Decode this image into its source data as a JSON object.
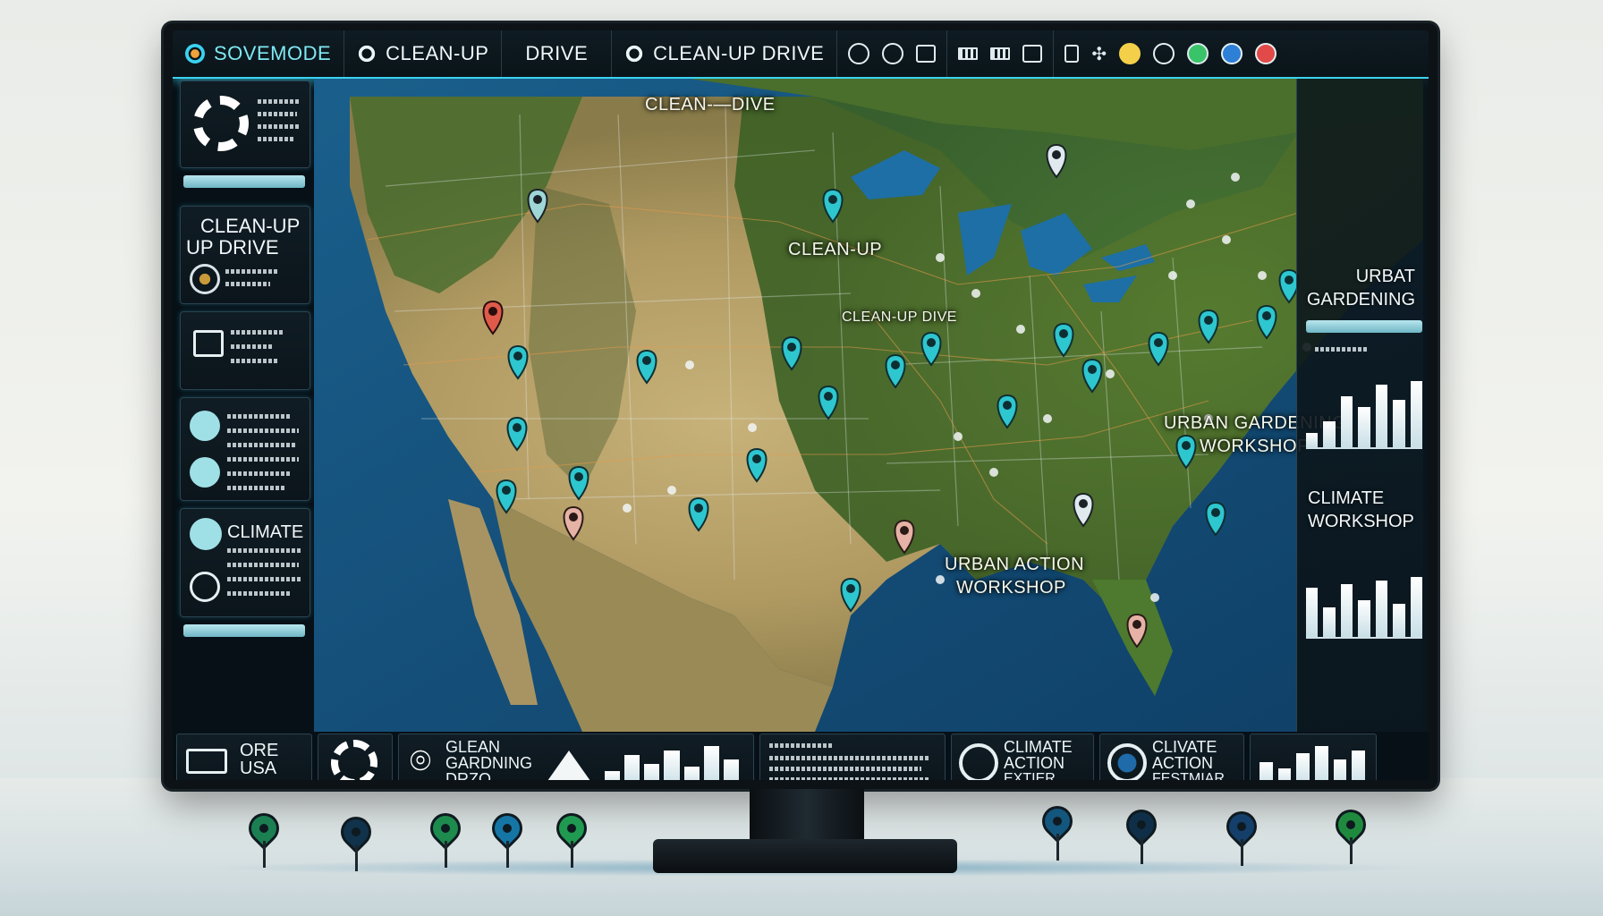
{
  "topbar": {
    "app_name": "SOVEMODE",
    "tab1": "CLEAN-UP",
    "tab2": "DRIVE",
    "tab3": "CLEAN-UP DRIVE"
  },
  "map": {
    "labels": {
      "top": "CLEAN-—DIVE",
      "center": "CLEAN-UP",
      "mid": "CLEAN-UP DIVE",
      "east": "URBAN GARDENING",
      "east2": "WORKSHOP",
      "gulf1": "URBAN ACTION",
      "gulf2": "WORKSHOP"
    },
    "colors": {
      "pin": "#2ec6cf",
      "land": "#6e8a3a",
      "ocean": "#1e6b9e"
    }
  },
  "left_panel": {
    "card2_line1": "CLEAN-UP",
    "card2_line2": "UP DRIVE",
    "card5_title": "CLIMATE"
  },
  "right_panel": {
    "title1_line1": "URBAT",
    "title1_line2": "GARDENING",
    "title2_line1": "CLIMATE",
    "title2_line2": "WORKSHOP"
  },
  "bottom_bar": {
    "card1_line1": "ORE",
    "card1_line2": "USA",
    "card3_line1": "GLEAN",
    "card3_line2": "GARDNING",
    "card3_line3": "DRZO",
    "card5_line1": "CLIMATE",
    "card5_line2": "ACTION",
    "card5_line3": "EXTIER",
    "card6_line1": "CLIVATE",
    "card6_line2": "ACTION",
    "card6_line3": "FESTMIAR"
  }
}
